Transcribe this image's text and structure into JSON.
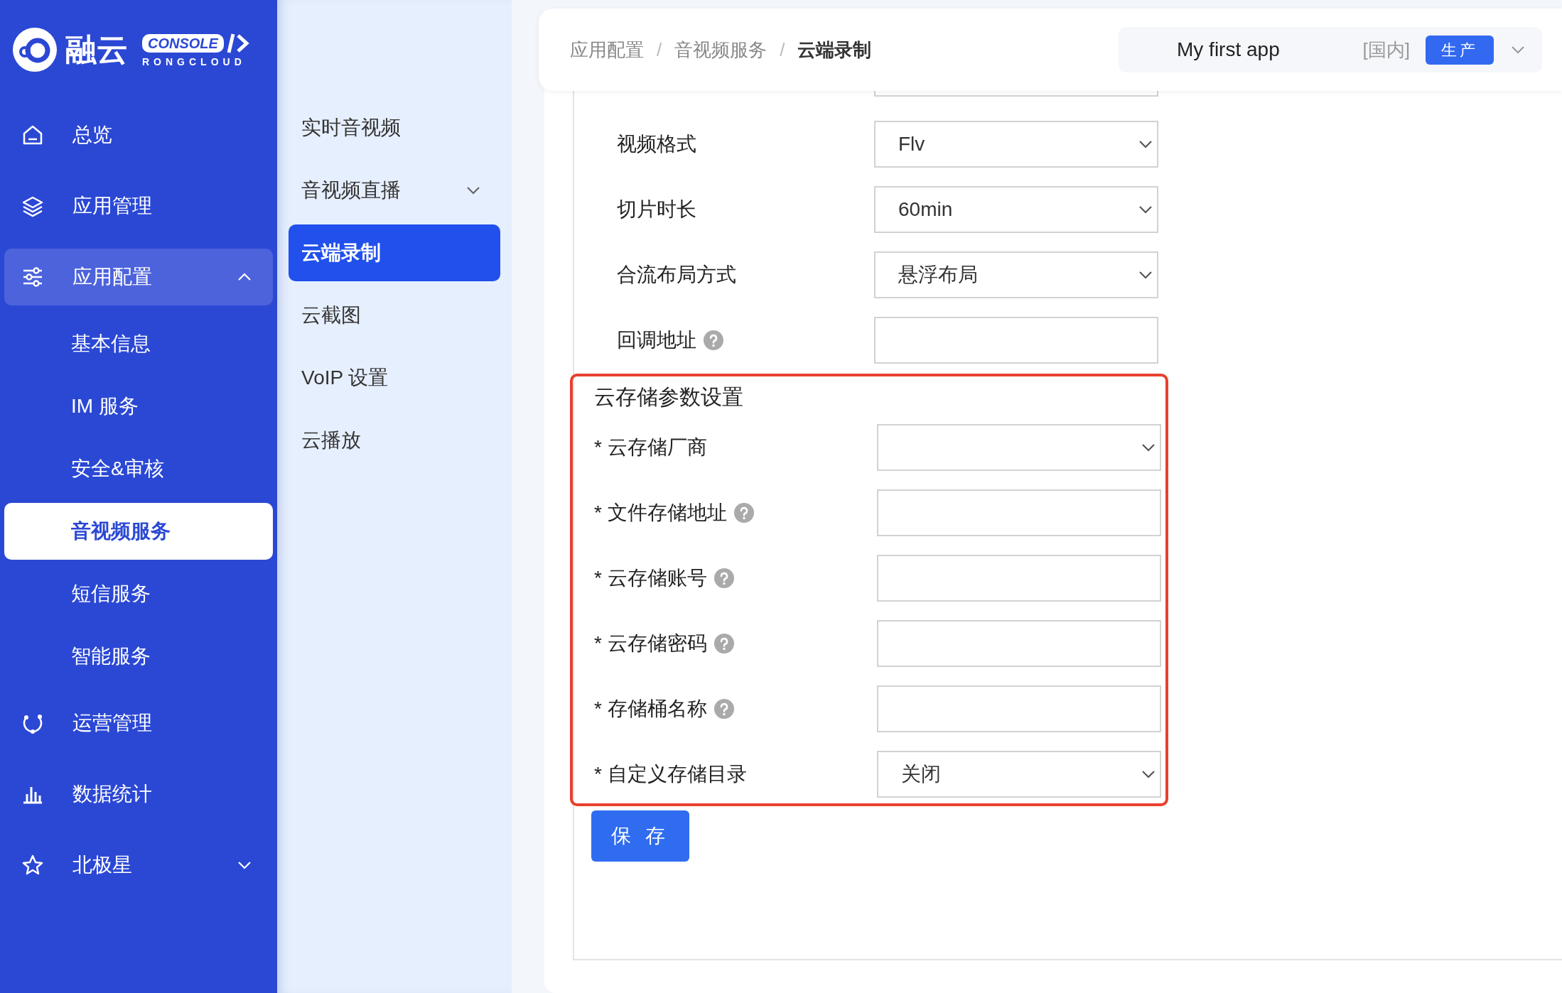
{
  "sidebar": {
    "logo": {
      "name": "融云",
      "badge": "CONSOLE",
      "subtitle": "RONGCLOUD"
    },
    "items": [
      {
        "label": "总览",
        "selected": false
      },
      {
        "label": "应用管理",
        "selected": false
      },
      {
        "label": "应用配置",
        "selected": false,
        "expanded": true,
        "children": [
          {
            "label": "基本信息",
            "selected": false
          },
          {
            "label": "IM 服务",
            "selected": false
          },
          {
            "label": "安全&审核",
            "selected": false
          },
          {
            "label": "音视频服务",
            "selected": true
          },
          {
            "label": "短信服务",
            "selected": false
          },
          {
            "label": "智能服务",
            "selected": false
          }
        ]
      },
      {
        "label": "运营管理",
        "selected": false
      },
      {
        "label": "数据统计",
        "selected": false
      },
      {
        "label": "北极星",
        "selected": false,
        "expanded": false
      }
    ]
  },
  "submenu": [
    {
      "label": "实时音视频",
      "selected": false
    },
    {
      "label": "音视频直播",
      "selected": false,
      "expanded": false
    },
    {
      "label": "云端录制",
      "selected": true
    },
    {
      "label": "云截图",
      "selected": false
    },
    {
      "label": "VoIP 设置",
      "selected": false
    },
    {
      "label": "云播放",
      "selected": false
    }
  ],
  "header": {
    "breadcrumb": [
      "应用配置",
      "音视频服务",
      "云端录制"
    ],
    "separator": "/",
    "app": {
      "name": "My first app",
      "region": "[国内]",
      "env": "生产"
    }
  },
  "form": {
    "rows": [
      {
        "kind": "select",
        "label": "视频格式",
        "value": "Flv",
        "help": false
      },
      {
        "kind": "select",
        "label": "切片时长",
        "value": "60min",
        "help": false
      },
      {
        "kind": "select",
        "label": "合流布局方式",
        "value": "悬浮布局",
        "help": false
      },
      {
        "kind": "input",
        "label": "回调地址",
        "help": true
      }
    ],
    "section": {
      "title": "云存储参数设置",
      "rows": [
        {
          "kind": "select",
          "label": "* 云存储厂商",
          "help": false
        },
        {
          "kind": "input",
          "label": "* 文件存储地址",
          "help": true
        },
        {
          "kind": "input",
          "label": "* 云存储账号",
          "help": true
        },
        {
          "kind": "input",
          "label": "* 云存储密码",
          "help": true
        },
        {
          "kind": "input",
          "label": "* 存储桶名称",
          "help": true
        },
        {
          "kind": "select",
          "label": "* 自定义存储目录",
          "value": "关闭",
          "help": false
        }
      ]
    },
    "save_button": "保 存"
  }
}
